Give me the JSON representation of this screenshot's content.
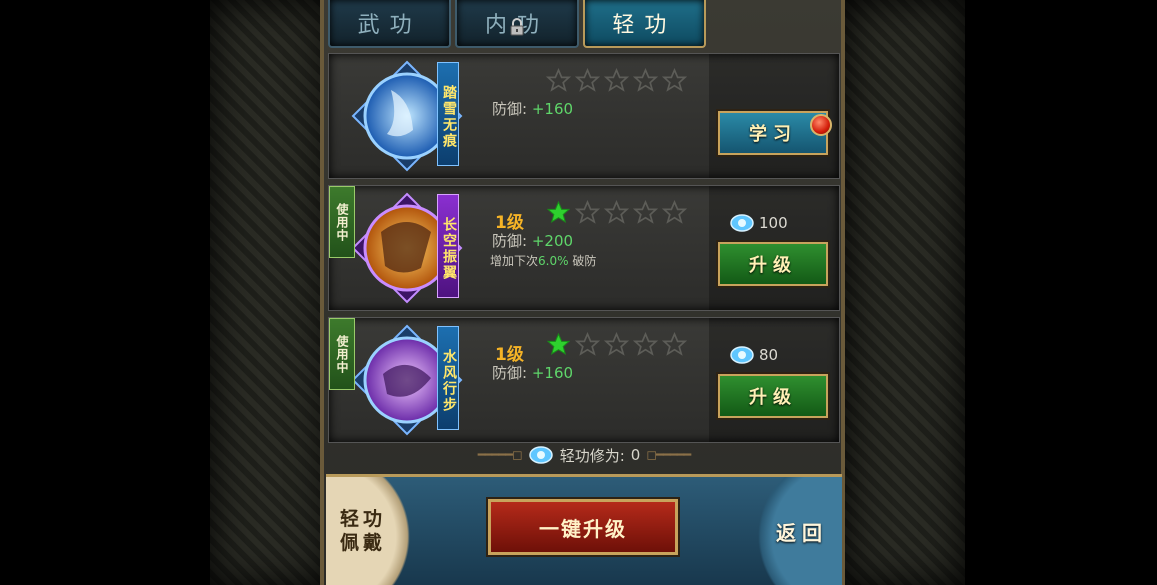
{
  "tabs": [
    {
      "label": "武功",
      "active": false
    },
    {
      "label": "内功",
      "active": false,
      "locked": true
    },
    {
      "label": "轻功",
      "active": true
    }
  ],
  "skills": [
    {
      "name": "踏雪无痕",
      "ribbon_color": "blue",
      "in_use": false,
      "level": "",
      "stars_filled": 0,
      "stars_total": 5,
      "attr_label": "防御:",
      "attr_value": "+160",
      "extra_prefix": "",
      "extra_value": "",
      "extra_suffix": "",
      "cost": "",
      "button": "学习",
      "notify_dot": true
    },
    {
      "name": "长空振翼",
      "ribbon_color": "purple",
      "in_use": true,
      "in_use_label": "使用中",
      "level": "1级",
      "stars_filled": 1,
      "stars_total": 5,
      "attr_label": "防御:",
      "attr_value": "+200",
      "extra_prefix": "增加下次",
      "extra_value": "6.0%",
      "extra_suffix": "破防",
      "cost": "100",
      "button": "升级"
    },
    {
      "name": "水风行步",
      "ribbon_color": "blue",
      "in_use": true,
      "in_use_label": "使用中",
      "level": "1级",
      "stars_filled": 1,
      "stars_total": 5,
      "attr_label": "防御:",
      "attr_value": "+160",
      "extra_prefix": "",
      "extra_value": "",
      "extra_suffix": "",
      "cost": "80",
      "button": "升级"
    }
  ],
  "cultivation": {
    "label": "轻功修为:",
    "value": "0"
  },
  "bottom": {
    "equip_line1": "轻功",
    "equip_line2": "佩戴",
    "one_key_upgrade": "一键升级",
    "back": "返回"
  },
  "colors": {
    "gold": "#f5b326",
    "green_value": "#5fd66a",
    "star_filled": "#2ed12e",
    "star_empty": "#5d5d58"
  }
}
